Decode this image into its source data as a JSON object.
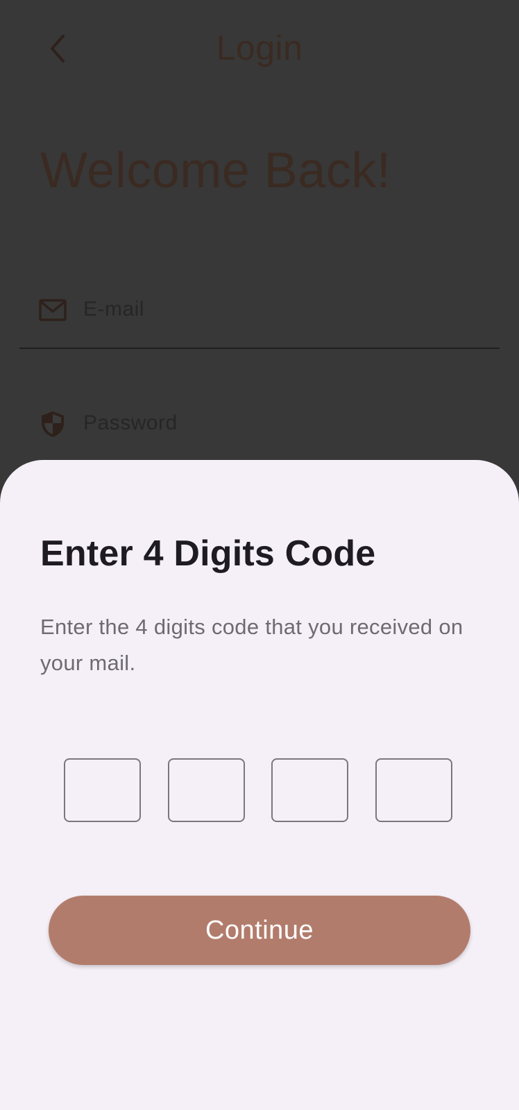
{
  "colors": {
    "scrim_background": "#383838",
    "sheet_background": "#f5f0f7",
    "accent": "#b27c6c",
    "dimmed_text": "#3a2a22"
  },
  "login": {
    "title": "Login",
    "welcome": "Welcome Back!",
    "back_icon": "chevron-left-icon",
    "email": {
      "icon": "mail-icon",
      "placeholder": "E-mail"
    },
    "password": {
      "icon": "shield-icon",
      "placeholder": "Password"
    }
  },
  "sheet": {
    "title": "Enter 4 Digits Code",
    "subtitle": "Enter the 4 digits code that you received on your mail.",
    "code_digits": [
      "",
      "",
      "",
      ""
    ],
    "continue_label": "Continue"
  }
}
